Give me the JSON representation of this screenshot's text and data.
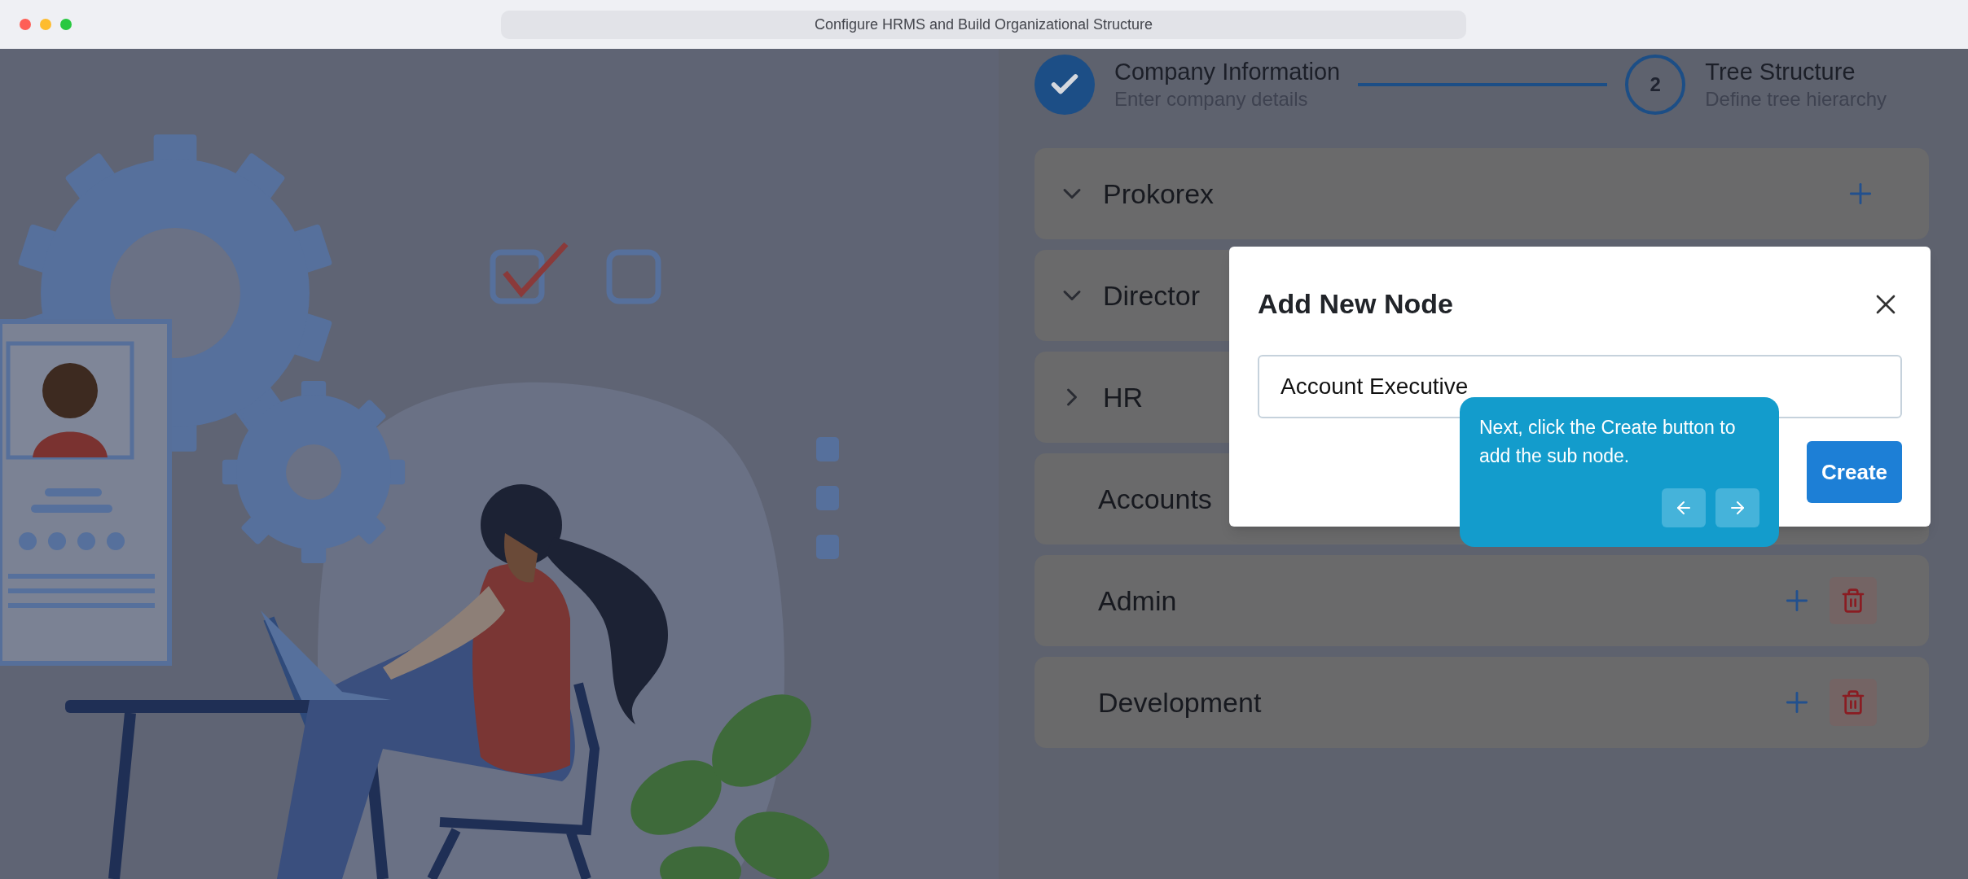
{
  "window": {
    "title": "Configure HRMS and Build Organizational Structure"
  },
  "stepper": [
    {
      "kind": "done",
      "title": "Company Information",
      "subtitle": "Enter company details"
    },
    {
      "kind": "current",
      "number": "2",
      "title": "Tree Structure",
      "subtitle": "Define tree hierarchy"
    }
  ],
  "tree": [
    {
      "label": "Prokorex",
      "kind": "parent",
      "expanded": true,
      "can_add": true,
      "can_delete": false
    },
    {
      "label": "Director",
      "kind": "parent",
      "expanded": true
    },
    {
      "label": "HR",
      "kind": "parent",
      "expanded": false
    },
    {
      "label": "Accounts",
      "kind": "leaf"
    },
    {
      "label": "Admin",
      "kind": "leaf",
      "can_add": true,
      "can_delete": true
    },
    {
      "label": "Development",
      "kind": "leaf",
      "can_add": true,
      "can_delete": true
    }
  ],
  "dialog": {
    "title": "Add New Node",
    "value": "Account Executive",
    "button": "Create"
  },
  "tooltip": {
    "text": "Next, click the Create button to add the sub node."
  }
}
